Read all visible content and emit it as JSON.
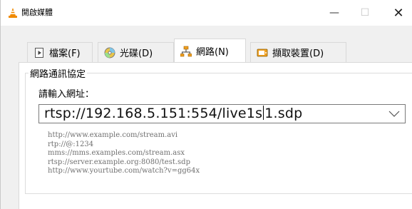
{
  "window": {
    "title": "開啟媒體",
    "controls": {
      "minimize": "—",
      "maximize": "☐",
      "close": "✕"
    }
  },
  "tabs": [
    {
      "label": "檔案(F)",
      "icon": "file-icon",
      "active": false
    },
    {
      "label": "光碟(D)",
      "icon": "disc-icon",
      "active": false
    },
    {
      "label": "網路(N)",
      "icon": "network-icon",
      "active": true
    },
    {
      "label": "擷取裝置(D)",
      "icon": "capture-device-icon",
      "active": false
    }
  ],
  "network": {
    "group_title": "網路通訊協定",
    "prompt": "請輸入網址：",
    "url_value_before_cursor": "rtsp://192.168.5.151:554/live1s",
    "url_value_after_cursor": "1.sdp",
    "examples": [
      "http://www.example.com/stream.avi",
      "rtp://@:1234",
      "mms://mms.examples.com/stream.asx",
      "rtsp://server.example.org:8080/test.sdp",
      "http://www.yourtube.com/watch?v=gg64x"
    ]
  },
  "colors": {
    "accent_orange": "#f08a00",
    "tab_active_bg": "#ffffff",
    "window_bg": "#f0f0f0",
    "example_text": "#707070"
  }
}
